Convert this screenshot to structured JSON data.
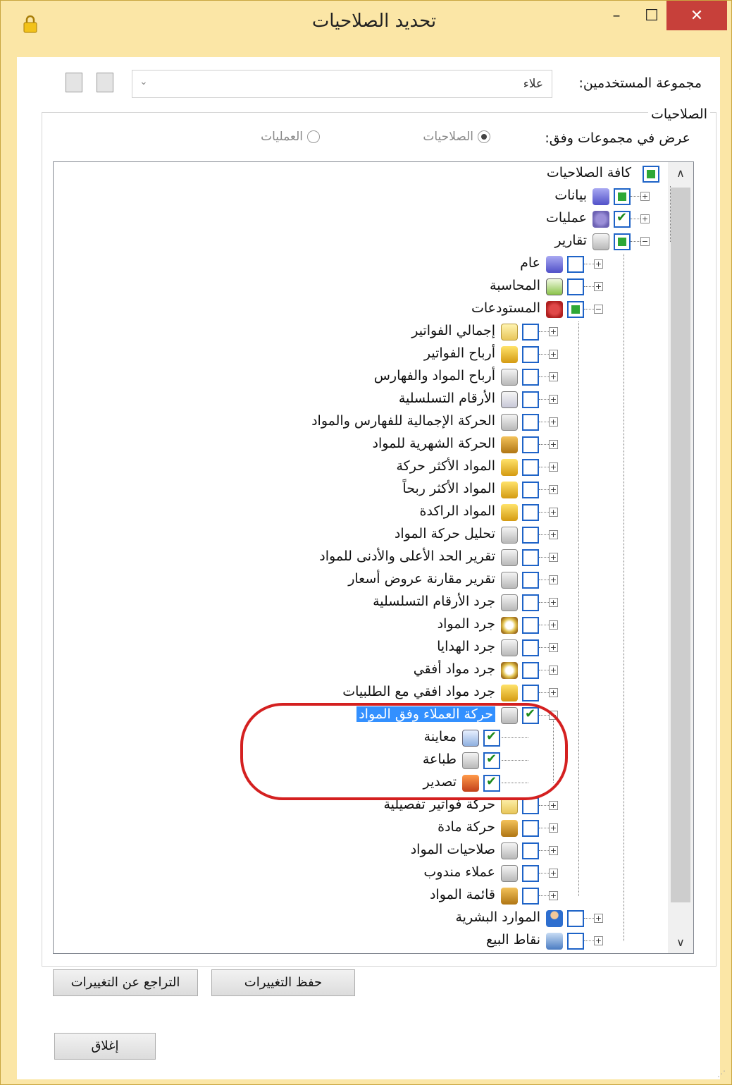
{
  "window": {
    "title": "تحديد الصلاحيات",
    "controls": {
      "minimize": "–",
      "maximize": "☐",
      "close": "✕"
    },
    "title_icon": "lock-icon"
  },
  "user_group": {
    "label": "مجموعة المستخدمين:",
    "value": "علاء",
    "dropdown_arrow": "⌄"
  },
  "permissions_group": {
    "title": "الصلاحيات",
    "view_by_label": "عرض في مجموعات وفق:",
    "radio_permissions": "الصلاحيات",
    "radio_operations": "العمليات",
    "selected": "الصلاحيات"
  },
  "tree": [
    {
      "label": "كافة الصلاحيات",
      "level": 0,
      "expander": "",
      "check": "partial",
      "icon": ""
    },
    {
      "label": "بيانات",
      "level": 1,
      "expander": "+",
      "check": "partial",
      "icon": "database-icon"
    },
    {
      "label": "عمليات",
      "level": 1,
      "expander": "+",
      "check": "checked",
      "icon": "gears-icon"
    },
    {
      "label": "تقارير",
      "level": 1,
      "expander": "−",
      "check": "partial",
      "icon": "printer-icon"
    },
    {
      "label": "عام",
      "level": 2,
      "expander": "+",
      "check": "none",
      "icon": "database-icon"
    },
    {
      "label": "المحاسبة",
      "level": 2,
      "expander": "+",
      "check": "none",
      "icon": "accounting-icon"
    },
    {
      "label": "المستودعات",
      "level": 2,
      "expander": "−",
      "check": "partial",
      "icon": "warehouse-icon"
    },
    {
      "label": "إجمالي الفواتير",
      "level": 3,
      "expander": "+",
      "check": "none",
      "icon": "invoice-icon"
    },
    {
      "label": "أرباح الفواتير",
      "level": 3,
      "expander": "+",
      "check": "none",
      "icon": "lock-icon"
    },
    {
      "label": "أرباح المواد والفهارس",
      "level": 3,
      "expander": "+",
      "check": "none",
      "icon": "printer-icon"
    },
    {
      "label": "الأرقام التسلسلية",
      "level": 3,
      "expander": "+",
      "check": "none",
      "icon": "calculator-icon"
    },
    {
      "label": "الحركة الإجمالية للفهارس والمواد",
      "level": 3,
      "expander": "+",
      "check": "none",
      "icon": "printer-icon"
    },
    {
      "label": "الحركة الشهرية للمواد",
      "level": 3,
      "expander": "+",
      "check": "none",
      "icon": "box-icon"
    },
    {
      "label": "المواد الأكثر حركة",
      "level": 3,
      "expander": "+",
      "check": "none",
      "icon": "lock-icon"
    },
    {
      "label": "المواد الأكثر ربحاً",
      "level": 3,
      "expander": "+",
      "check": "none",
      "icon": "lock-icon"
    },
    {
      "label": "المواد الراكدة",
      "level": 3,
      "expander": "+",
      "check": "none",
      "icon": "lock-icon"
    },
    {
      "label": "تحليل حركة المواد",
      "level": 3,
      "expander": "+",
      "check": "none",
      "icon": "printer-icon"
    },
    {
      "label": "تقرير الحد الأعلى والأدنى للمواد",
      "level": 3,
      "expander": "+",
      "check": "none",
      "icon": "printer-icon"
    },
    {
      "label": "تقرير مقارنة عروض أسعار",
      "level": 3,
      "expander": "+",
      "check": "none",
      "icon": "printer-icon"
    },
    {
      "label": "جرد الأرقام التسلسلية",
      "level": 3,
      "expander": "+",
      "check": "none",
      "icon": "printer-icon"
    },
    {
      "label": "جرد المواد",
      "level": 3,
      "expander": "+",
      "check": "none",
      "icon": "search-icon"
    },
    {
      "label": "جرد الهدايا",
      "level": 3,
      "expander": "+",
      "check": "none",
      "icon": "printer-icon"
    },
    {
      "label": "جرد مواد أفقي",
      "level": 3,
      "expander": "+",
      "check": "none",
      "icon": "search-icon"
    },
    {
      "label": "جرد مواد افقي مع الطلبيات",
      "level": 3,
      "expander": "+",
      "check": "none",
      "icon": "lock-icon"
    },
    {
      "label": "حركة العملاء وفق المواد",
      "level": 3,
      "expander": "−",
      "check": "checked",
      "icon": "printer-icon",
      "selected": true
    },
    {
      "label": "معاينة",
      "level": 4,
      "expander": "",
      "check": "checked",
      "icon": "preview-icon"
    },
    {
      "label": "طباعة",
      "level": 4,
      "expander": "",
      "check": "checked",
      "icon": "printer-icon"
    },
    {
      "label": "تصدير",
      "level": 4,
      "expander": "",
      "check": "checked",
      "icon": "export-icon"
    },
    {
      "label": "حركة فواتير تفصيلية",
      "level": 3,
      "expander": "+",
      "check": "none",
      "icon": "invoice-icon"
    },
    {
      "label": "حركة مادة",
      "level": 3,
      "expander": "+",
      "check": "none",
      "icon": "box-icon"
    },
    {
      "label": "صلاحيات المواد",
      "level": 3,
      "expander": "+",
      "check": "none",
      "icon": "printer-icon"
    },
    {
      "label": "عملاء مندوب",
      "level": 3,
      "expander": "+",
      "check": "none",
      "icon": "printer-icon"
    },
    {
      "label": "قائمة المواد",
      "level": 3,
      "expander": "+",
      "check": "none",
      "icon": "box-icon"
    },
    {
      "label": "الموارد البشرية",
      "level": 2,
      "expander": "+",
      "check": "none",
      "icon": "person-icon"
    },
    {
      "label": "نقاط البيع",
      "level": 2,
      "expander": "+",
      "check": "none",
      "icon": "pos-icon"
    }
  ],
  "scrollbar": {
    "up": "∧",
    "down": "∨"
  },
  "buttons": {
    "save": "حفظ التغييرات",
    "revert": "التراجع عن التغييرات",
    "close": "إغلاق"
  },
  "colors": {
    "title_bar": "#fbe6a6",
    "close_button": "#c7403a",
    "selection": "#3390ff",
    "checkbox_border": "#1e63c7",
    "check_mark": "#1c8a1c",
    "highlight_outline": "#d42020"
  }
}
